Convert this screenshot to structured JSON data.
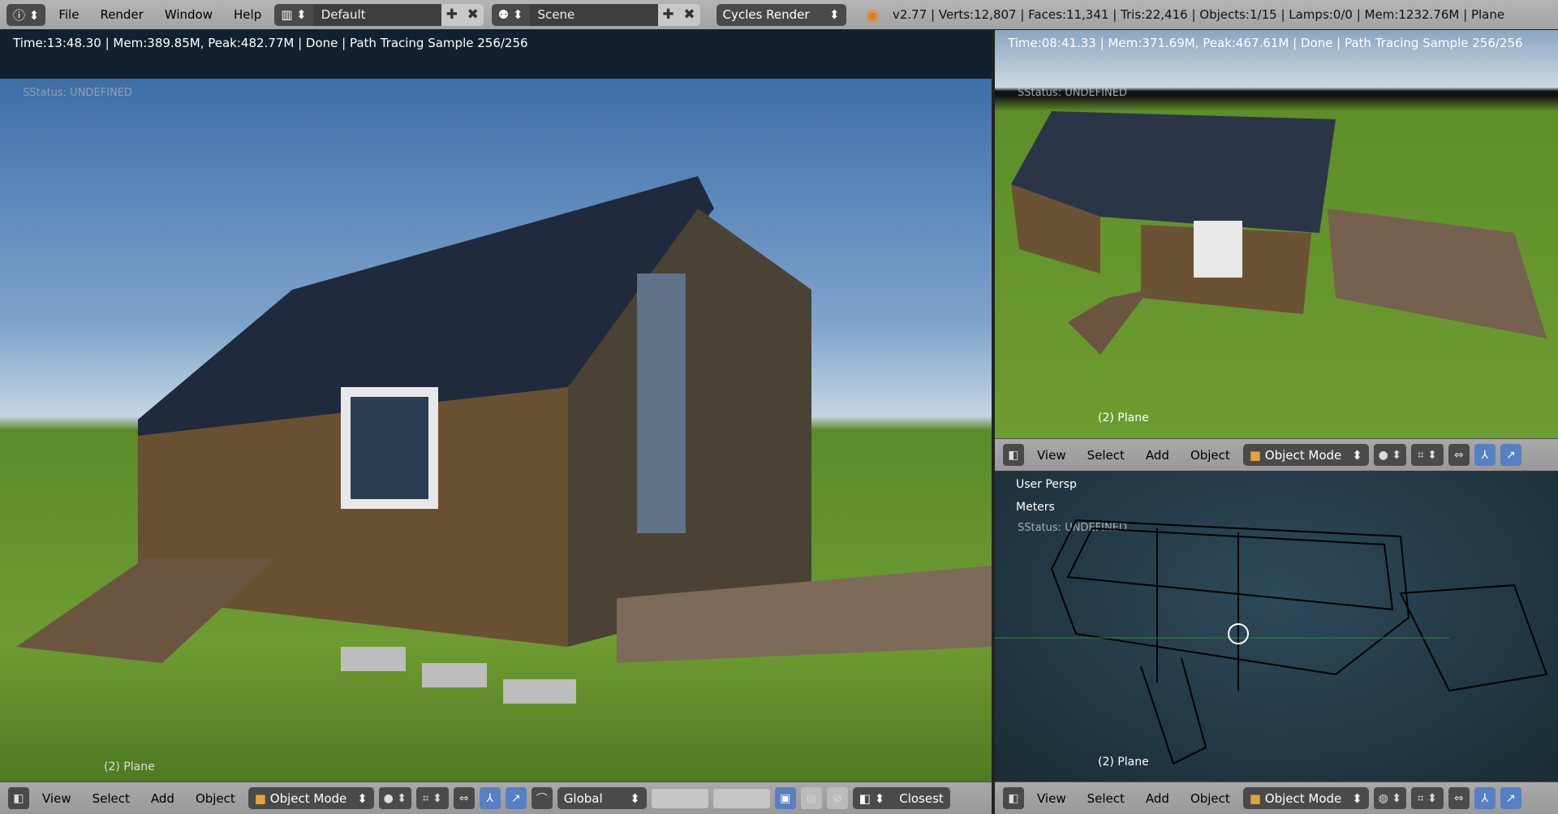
{
  "topbar": {
    "menus": [
      "File",
      "Render",
      "Window",
      "Help"
    ],
    "layout": "Default",
    "scene": "Scene",
    "engine": "Cycles Render",
    "stats": "v2.77 | Verts:12,807 | Faces:11,341 | Tris:22,416 | Objects:1/15 | Lamps:0/0 | Mem:1232.76M | Plane"
  },
  "left_view": {
    "render_info": "Time:13:48.30 | Mem:389.85M, Peak:482.77M | Done | Path Tracing Sample 256/256",
    "status": "SStatus: UNDEFINED",
    "object": "(2) Plane"
  },
  "right_top_view": {
    "render_info": "Time:08:41.33 | Mem:371.69M, Peak:467.61M | Done | Path Tracing Sample 256/256",
    "status": "SStatus: UNDEFINED",
    "object": "(2) Plane"
  },
  "right_bottom_view": {
    "persp": "User Persp",
    "units": "Meters",
    "status": "SStatus: UNDEFINED",
    "object": "(2) Plane"
  },
  "header": {
    "menus": [
      "View",
      "Select",
      "Add",
      "Object"
    ],
    "mode": "Object Mode",
    "orientation": "Global",
    "snap": "Closest"
  }
}
